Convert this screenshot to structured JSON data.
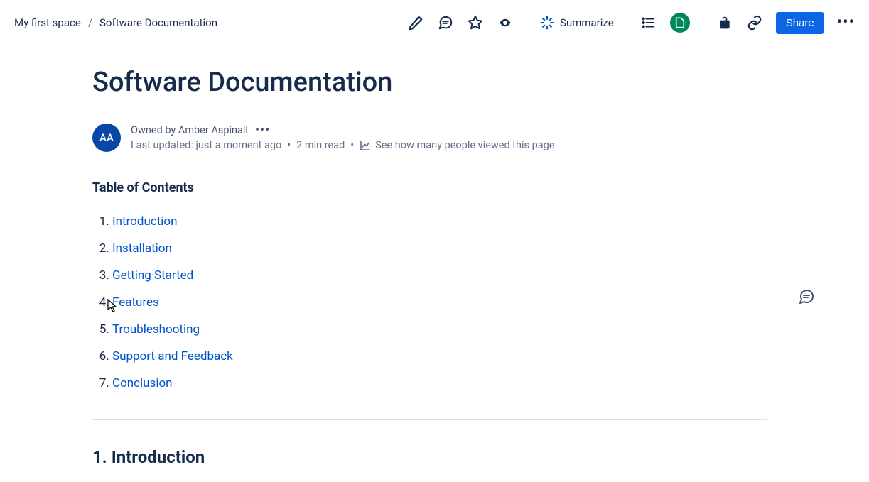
{
  "breadcrumb": {
    "space": "My first space",
    "page": "Software Documentation"
  },
  "toolbar": {
    "summarize": "Summarize",
    "share": "Share"
  },
  "page": {
    "title": "Software Documentation",
    "avatar_initials": "AA",
    "owned_by": "Owned by Amber Aspinall",
    "last_updated": "Last updated: just a moment ago",
    "read_time": "2 min read",
    "views_text": "See how many people viewed this page"
  },
  "toc": {
    "heading": "Table of Contents",
    "items": [
      "Introduction",
      "Installation",
      "Getting Started",
      "Features",
      "Troubleshooting",
      "Support and Feedback",
      "Conclusion"
    ]
  },
  "section": {
    "heading1": "1. Introduction"
  }
}
